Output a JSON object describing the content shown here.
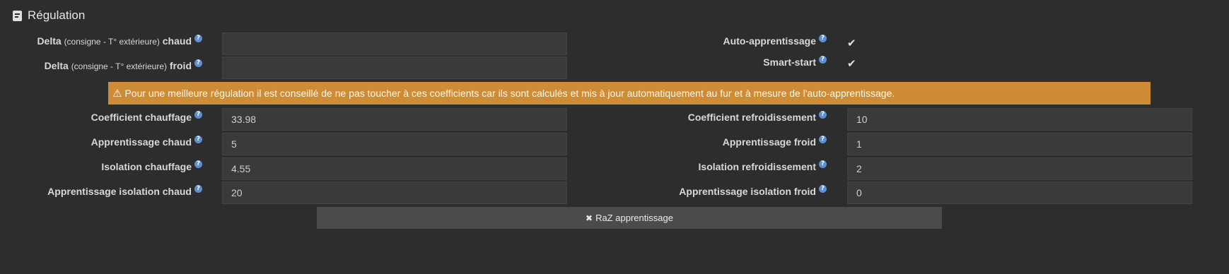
{
  "section": {
    "title": "Régulation",
    "icon": "document-icon"
  },
  "help_glyph": "?",
  "delta_hot": {
    "label_pre": "Delta ",
    "label_small": "(consigne - T° extérieure)",
    "label_post": " chaud",
    "value": ""
  },
  "delta_cold": {
    "label_pre": "Delta ",
    "label_small": "(consigne - T° extérieure)",
    "label_post": " froid",
    "value": ""
  },
  "auto_learning": {
    "label": "Auto-apprentissage",
    "checked": true
  },
  "smart_start": {
    "label": "Smart-start",
    "checked": true
  },
  "check_glyph": "✔",
  "warning": {
    "icon": "warning-icon",
    "glyph": "⚠",
    "text": "Pour une meilleure régulation il est conseillé de ne pas toucher à ces coefficients car ils sont calculés et mis à jour automatiquement au fur et à mesure de l'auto-apprentissage.",
    "color": "#cf8c36"
  },
  "coef_heat": {
    "label": "Coefficient chauffage",
    "value": "33.98"
  },
  "coef_cool": {
    "label": "Coefficient refroidissement",
    "value": "10"
  },
  "learn_hot": {
    "label": "Apprentissage chaud",
    "value": "5"
  },
  "learn_cold": {
    "label": "Apprentissage froid",
    "value": "1"
  },
  "insul_heat": {
    "label": "Isolation chauffage",
    "value": "4.55"
  },
  "insul_cool": {
    "label": "Isolation refroidissement",
    "value": "2"
  },
  "learn_insul_hot": {
    "label": "Apprentissage isolation chaud",
    "value": "20"
  },
  "learn_insul_cold": {
    "label": "Apprentissage isolation froid",
    "value": "0"
  },
  "reset_button": {
    "glyph": "✖",
    "label": "RaZ apprentissage"
  },
  "colors": {
    "background": "#2d2d2d",
    "input": "#3a3a3a",
    "help": "#5d8fd4",
    "button": "#4b4b4b"
  }
}
